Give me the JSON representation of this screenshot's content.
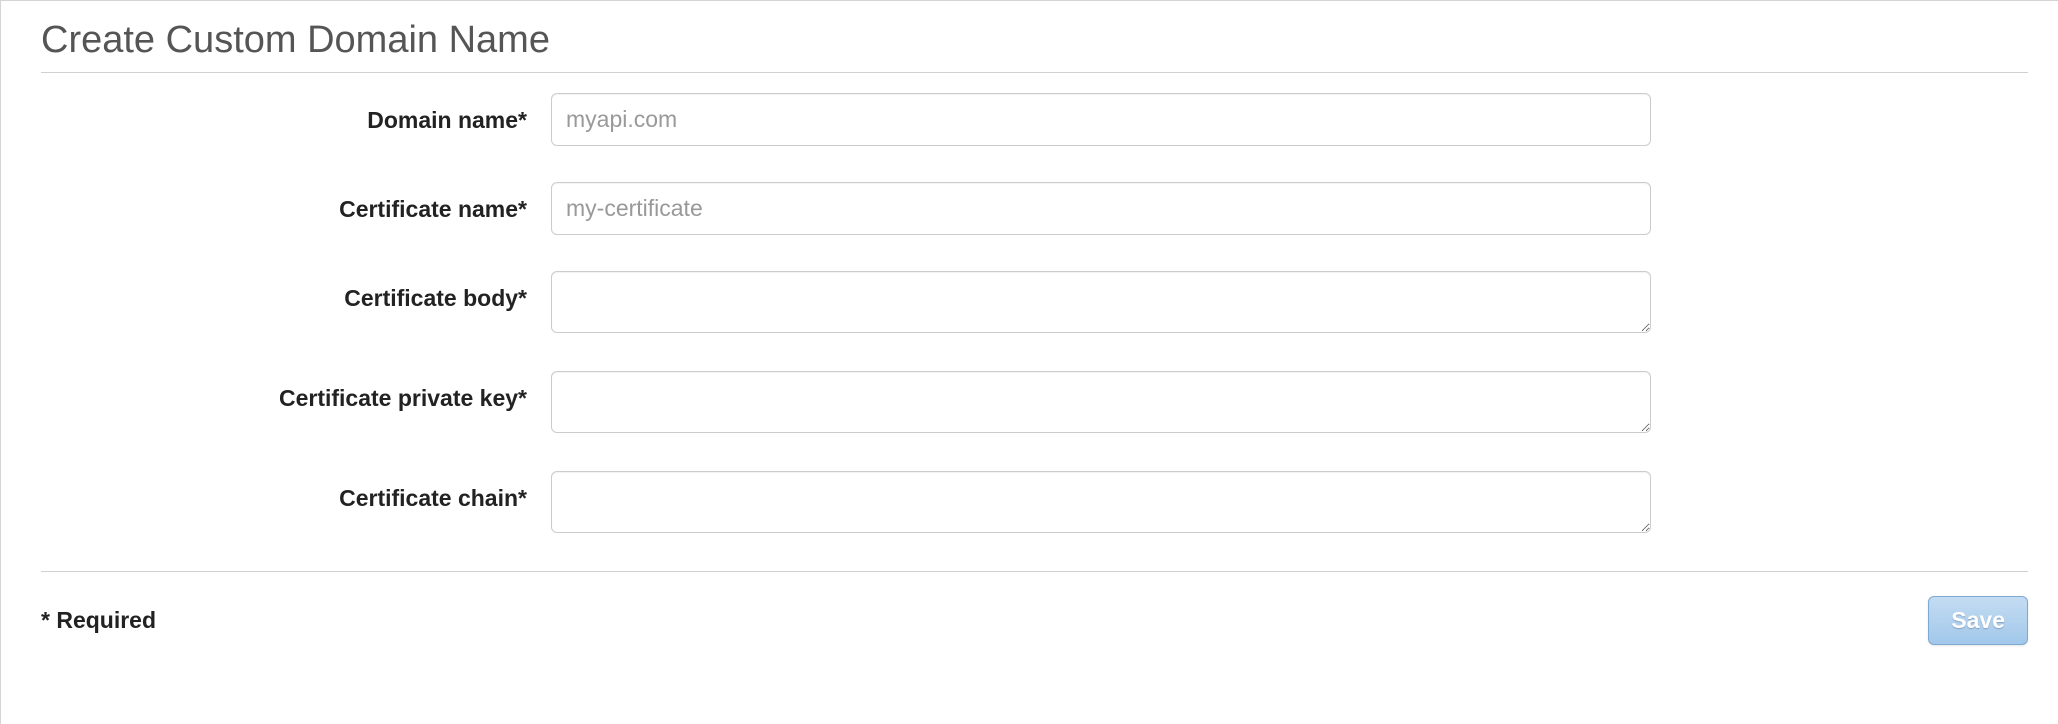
{
  "page": {
    "title": "Create Custom Domain Name"
  },
  "form": {
    "domain_name": {
      "label": "Domain name*",
      "placeholder": "myapi.com",
      "value": ""
    },
    "certificate_name": {
      "label": "Certificate name*",
      "placeholder": "my-certificate",
      "value": ""
    },
    "certificate_body": {
      "label": "Certificate body*",
      "value": ""
    },
    "certificate_private_key": {
      "label": "Certificate private key*",
      "value": ""
    },
    "certificate_chain": {
      "label": "Certificate chain*",
      "value": ""
    }
  },
  "footer": {
    "required_note": "* Required",
    "save_label": "Save"
  }
}
